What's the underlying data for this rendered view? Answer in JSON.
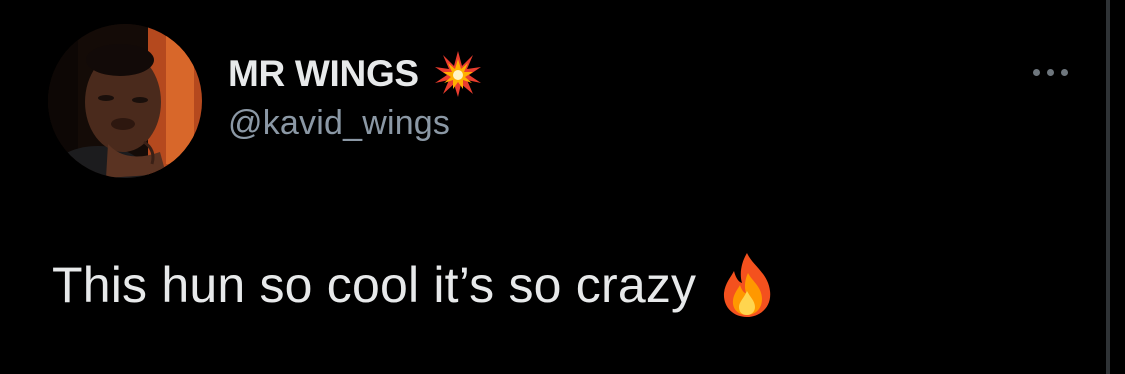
{
  "tweet": {
    "author": {
      "display_name": "MR WINGS",
      "name_emoji": "collision-emoji",
      "handle": "@kavid_wings",
      "avatar": "profile-photo"
    },
    "text": "This hun so cool it’s so crazy",
    "text_emoji": "fire-emoji",
    "more_icon": "more-horizontal-icon"
  },
  "colors": {
    "background": "#000000",
    "primary_text": "#e7e9ea",
    "secondary_text": "#8b98a5",
    "icon": "#6e767d",
    "divider": "#2f3336"
  }
}
